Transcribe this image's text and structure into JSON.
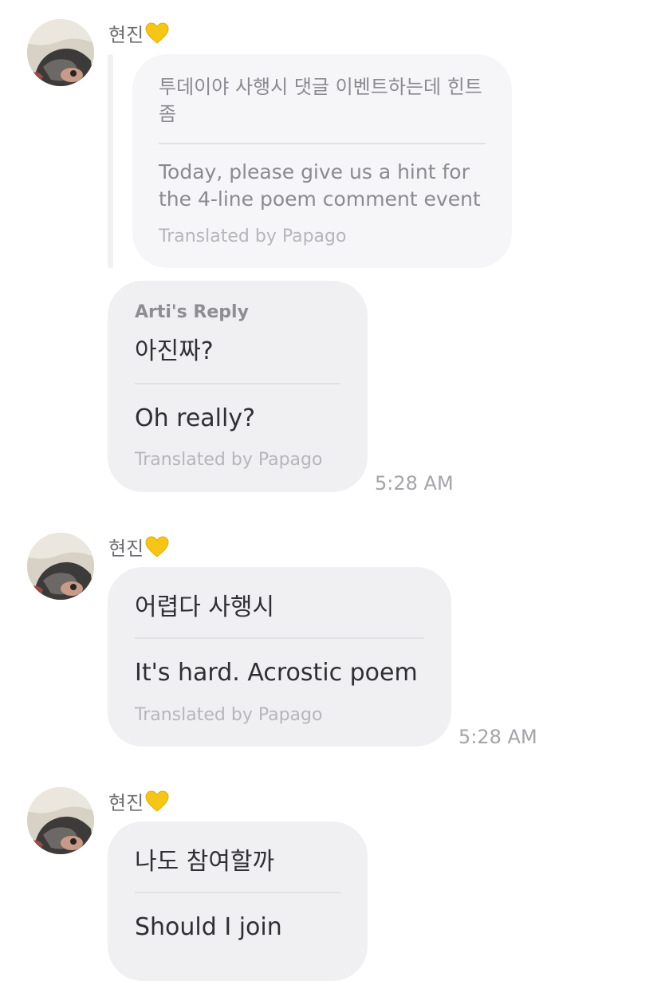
{
  "sender": {
    "name": "현진",
    "heart_color": "#F5C518"
  },
  "messages": [
    {
      "quoted": {
        "original": "투데이야 사행시 댓글 이벤트하는데 힌트 좀",
        "translation": "Today, please give us a hint for the 4-line poem comment event",
        "translated_by": "Translated by Papago"
      },
      "reply_label": "Arti's Reply",
      "original": "아진짜?",
      "translation": "Oh really?",
      "translated_by": "Translated by Papago",
      "time": "5:28 AM"
    },
    {
      "original": "어렵다 사행시",
      "translation": "It's hard. Acrostic poem",
      "translated_by": "Translated by Papago",
      "time": "5:28 AM"
    },
    {
      "original": "나도 참여할까",
      "translation": "Should I join"
    }
  ]
}
